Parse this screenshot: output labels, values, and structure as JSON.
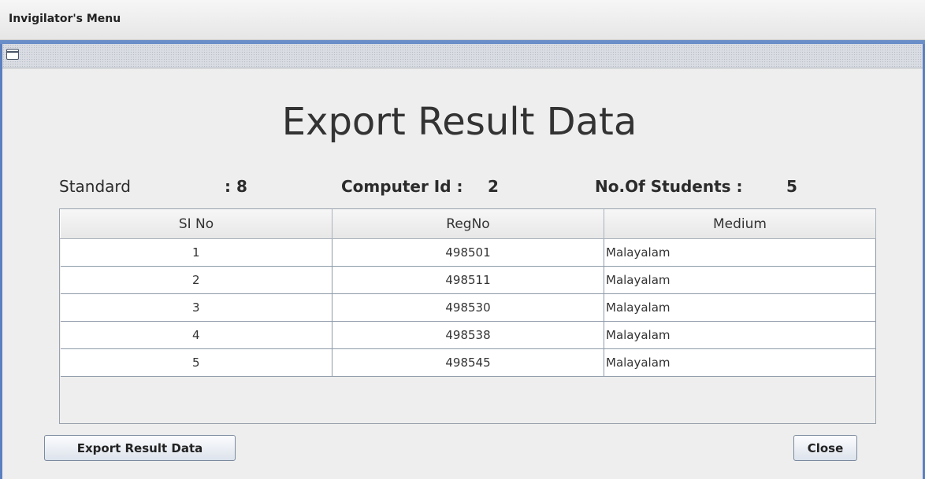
{
  "window": {
    "title": "Invigilator's Menu"
  },
  "icons": {
    "frame_icon": "window-icon"
  },
  "page": {
    "heading": "Export Result Data",
    "standard_label": "Standard",
    "standard_value": ": 8",
    "computer_id_label": "Computer Id :",
    "computer_id_value": "2",
    "students_label": "No.Of Students :",
    "students_value": "5"
  },
  "table": {
    "columns": [
      "SI No",
      "RegNo",
      "Medium"
    ],
    "rows": [
      [
        "1",
        "498501",
        "Malayalam"
      ],
      [
        "2",
        "498511",
        "Malayalam"
      ],
      [
        "3",
        "498530",
        "Malayalam"
      ],
      [
        "4",
        "498538",
        "Malayalam"
      ],
      [
        "5",
        "498545",
        "Malayalam"
      ]
    ]
  },
  "buttons": {
    "export": "Export Result Data",
    "close": "Close"
  },
  "colors": {
    "accent": "#6a8ec8",
    "border": "#5b7fbf"
  }
}
